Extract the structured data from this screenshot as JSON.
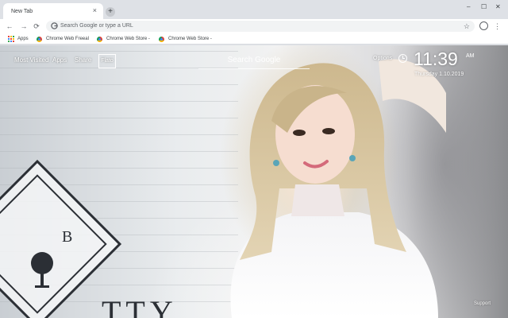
{
  "tab": {
    "title": "New Tab",
    "close_glyph": "×",
    "new_tab_glyph": "+"
  },
  "window_controls": {
    "minimize": "–",
    "maximize": "☐",
    "close": "✕"
  },
  "toolbar": {
    "back_glyph": "←",
    "forward_glyph": "→",
    "reload_glyph": "⟳",
    "omnibox_placeholder": "Search Google or type a URL",
    "star_glyph": "☆",
    "menu_glyph": "⋮"
  },
  "bookmarks": {
    "apps_label": "Apps",
    "apps_grid_colors": [
      "#ea4335",
      "#fbbc05",
      "#34a853",
      "#4285f4",
      "#ea4335",
      "#fbbc05",
      "#34a853",
      "#4285f4",
      "#ea4335"
    ],
    "items": [
      {
        "label": "Chrome Web Freeal"
      },
      {
        "label": "Chrome Web Store -"
      },
      {
        "label": "Chrome Web Store -"
      }
    ]
  },
  "ntp": {
    "nav": [
      {
        "label": "Most Visited"
      },
      {
        "label": "Apps"
      },
      {
        "label": "Share"
      }
    ],
    "flato_label": "Flato",
    "search_placeholder": "Search Google",
    "options_label": "Options",
    "time": "11:39",
    "ampm": "AM",
    "date": "Thursday  1.10.2019",
    "support_label": "Support"
  },
  "wallpaper": {
    "sign_letter": "B",
    "big_letters": "TTY"
  },
  "colors": {
    "tabstrip_bg": "#dee1e6",
    "toolbar_bg": "#ffffff",
    "omnibox_bg": "#f1f3f4",
    "ntp_text": "#ffffff"
  }
}
